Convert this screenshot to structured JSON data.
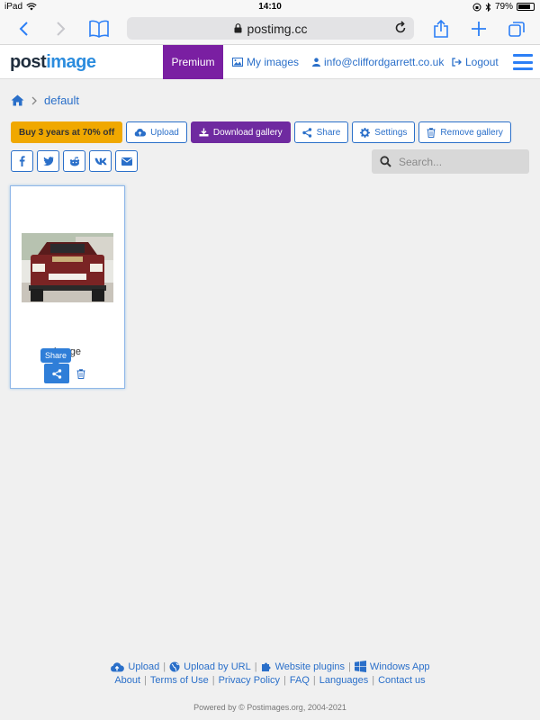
{
  "status_bar": {
    "device": "iPad",
    "time": "14:10",
    "battery": "79%",
    "battery_level": 0.79
  },
  "browser": {
    "url": "postimg.cc"
  },
  "navbar": {
    "logo_post": "post",
    "logo_image": "image",
    "premium": "Premium",
    "my_images": "My images",
    "account": "info@cliffordgarrett.co.uk",
    "logout": "Logout"
  },
  "breadcrumb": {
    "current": "default"
  },
  "toolbar": {
    "offer": "Buy 3 years at 70% off",
    "upload": "Upload",
    "download": "Download gallery",
    "share": "Share",
    "settings": "Settings",
    "remove": "Remove gallery"
  },
  "social": [
    "f",
    "t",
    "r",
    "vk",
    "mail"
  ],
  "search": {
    "placeholder": "Search..."
  },
  "gallery": {
    "items": [
      {
        "name": "image",
        "share_tooltip": "Share"
      }
    ]
  },
  "footer": {
    "links_row1": [
      "Upload",
      "Upload by URL",
      "Website plugins",
      "Windows App"
    ],
    "links_row2": [
      "About",
      "Terms of Use",
      "Privacy Policy",
      "FAQ",
      "Languages",
      "Contact us"
    ],
    "copyright": "Powered by © Postimages.org, 2004-2021"
  },
  "colors": {
    "accent": "#2a6fc9",
    "premium": "#7a1fa2",
    "download": "#6f2aa0",
    "offer": "#f0a800"
  }
}
